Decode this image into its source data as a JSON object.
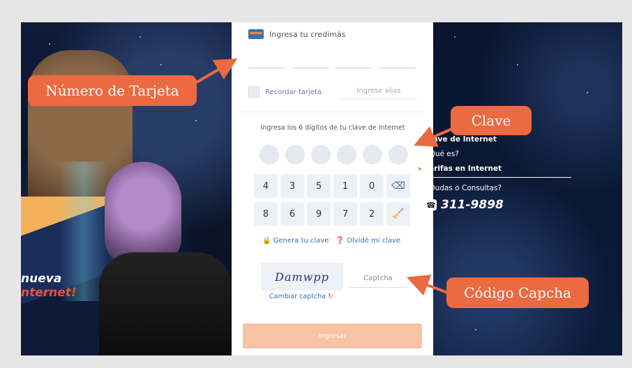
{
  "form": {
    "card_prompt": "Ingresa tu credimás",
    "remember_label": "Recordar tarjeta",
    "alias_placeholder": "Ingrese alias",
    "password_instruction": "Ingresa los 6 dígitos de tu clave de Internet",
    "keypad_row1": [
      "4",
      "3",
      "5",
      "1",
      "0"
    ],
    "keypad_row2": [
      "8",
      "6",
      "9",
      "7",
      "2"
    ],
    "backspace_icon": "backspace-icon",
    "clear_icon": "broom-icon",
    "generate_link": "Genera tu clave",
    "forgot_link": "Olvidé mi clave",
    "captcha_text": "Damwpp",
    "captcha_placeholder": "Captcha",
    "change_captcha": "Cambiar captcha",
    "submit_label": "Ingresar"
  },
  "sidebar": {
    "link1": "Clave de Internet",
    "link2": "¿Qué es?",
    "link3": "Tarifas en Internet",
    "help_text": "¿Dudas o Consultas?",
    "phone": "311-9898"
  },
  "promo": {
    "line1": "nueva",
    "line2": "nternet!"
  },
  "annotations": {
    "card_number": "Número  de Tarjeta",
    "password": "Clave",
    "captcha": "Código Capcha",
    "color": "#ec6a42"
  }
}
